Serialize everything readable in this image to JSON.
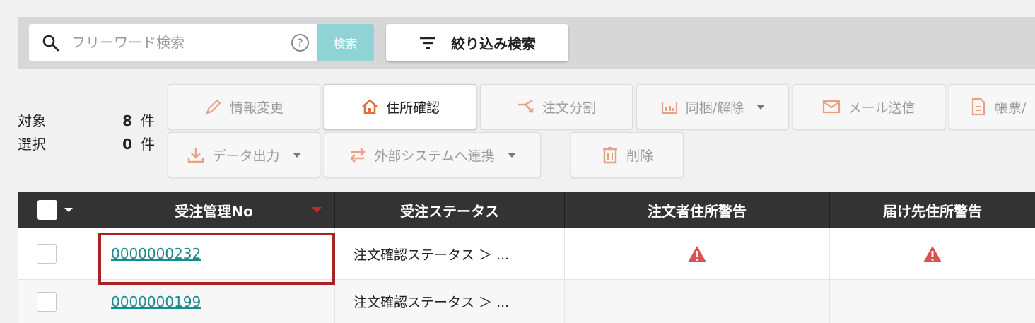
{
  "search": {
    "placeholder": "フリーワード検索",
    "button_label": "検索",
    "filter_label": "絞り込み検索"
  },
  "counts": {
    "target_label": "対象",
    "target_value": "8",
    "selected_label": "選択",
    "selected_value": "0",
    "unit": "件"
  },
  "actions": {
    "edit_info": "情報変更",
    "address_check": "住所確認",
    "split_order": "注文分割",
    "bundle": "同梱/解除",
    "send_mail": "メール送信",
    "forms": "帳票/",
    "export": "データ出力",
    "external_link": "外部システムへ連携",
    "delete": "削除"
  },
  "table": {
    "columns": [
      "受注管理No",
      "受注ステータス",
      "注文者住所警告",
      "届け先住所警告"
    ],
    "rows": [
      {
        "order_no": "0000000232",
        "status": "注文確認ステータス ＞ ...",
        "orderer_warning": true,
        "recipient_warning": true
      },
      {
        "order_no": "0000000199",
        "status": "注文確認ステータス ＞ ...",
        "orderer_warning": false,
        "recipient_warning": false
      }
    ]
  },
  "colors": {
    "accent": "#1a8a8c",
    "search_button": "#8fd3d6",
    "warning": "#d9534f",
    "icon_orange": "#e0703a",
    "highlight": "#a82424"
  }
}
